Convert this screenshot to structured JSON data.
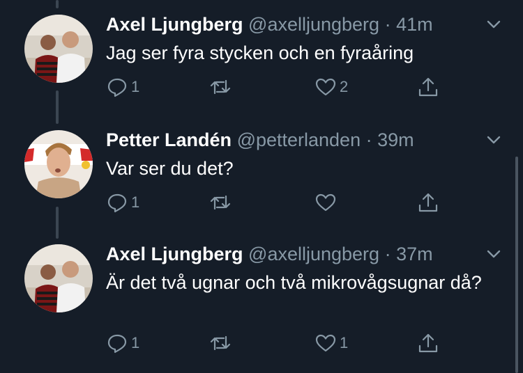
{
  "tweets": [
    {
      "name": "Axel Ljungberg",
      "handle": "@axelljungberg",
      "time": "41m",
      "text": "Jag ser fyra stycken och en fyraåring",
      "reply_count": "1",
      "retweet_count": "",
      "like_count": "2"
    },
    {
      "name": "Petter Landén",
      "handle": "@petterlanden",
      "time": "39m",
      "text": "Var ser du det?",
      "reply_count": "1",
      "retweet_count": "",
      "like_count": ""
    },
    {
      "name": "Axel Ljungberg",
      "handle": "@axelljungberg",
      "time": "37m",
      "text": "Är det två ugnar och två mikrovågsugnar då?",
      "reply_count": "1",
      "retweet_count": "",
      "like_count": "1"
    }
  ],
  "separator": " · ",
  "icons": {
    "reply": "reply-icon",
    "retweet": "retweet-icon",
    "like": "heart-icon",
    "share": "share-icon",
    "more": "chevron-down-icon"
  },
  "colors": {
    "background": "#151d28",
    "muted": "#8899a6",
    "thread_line": "#3b4652"
  }
}
